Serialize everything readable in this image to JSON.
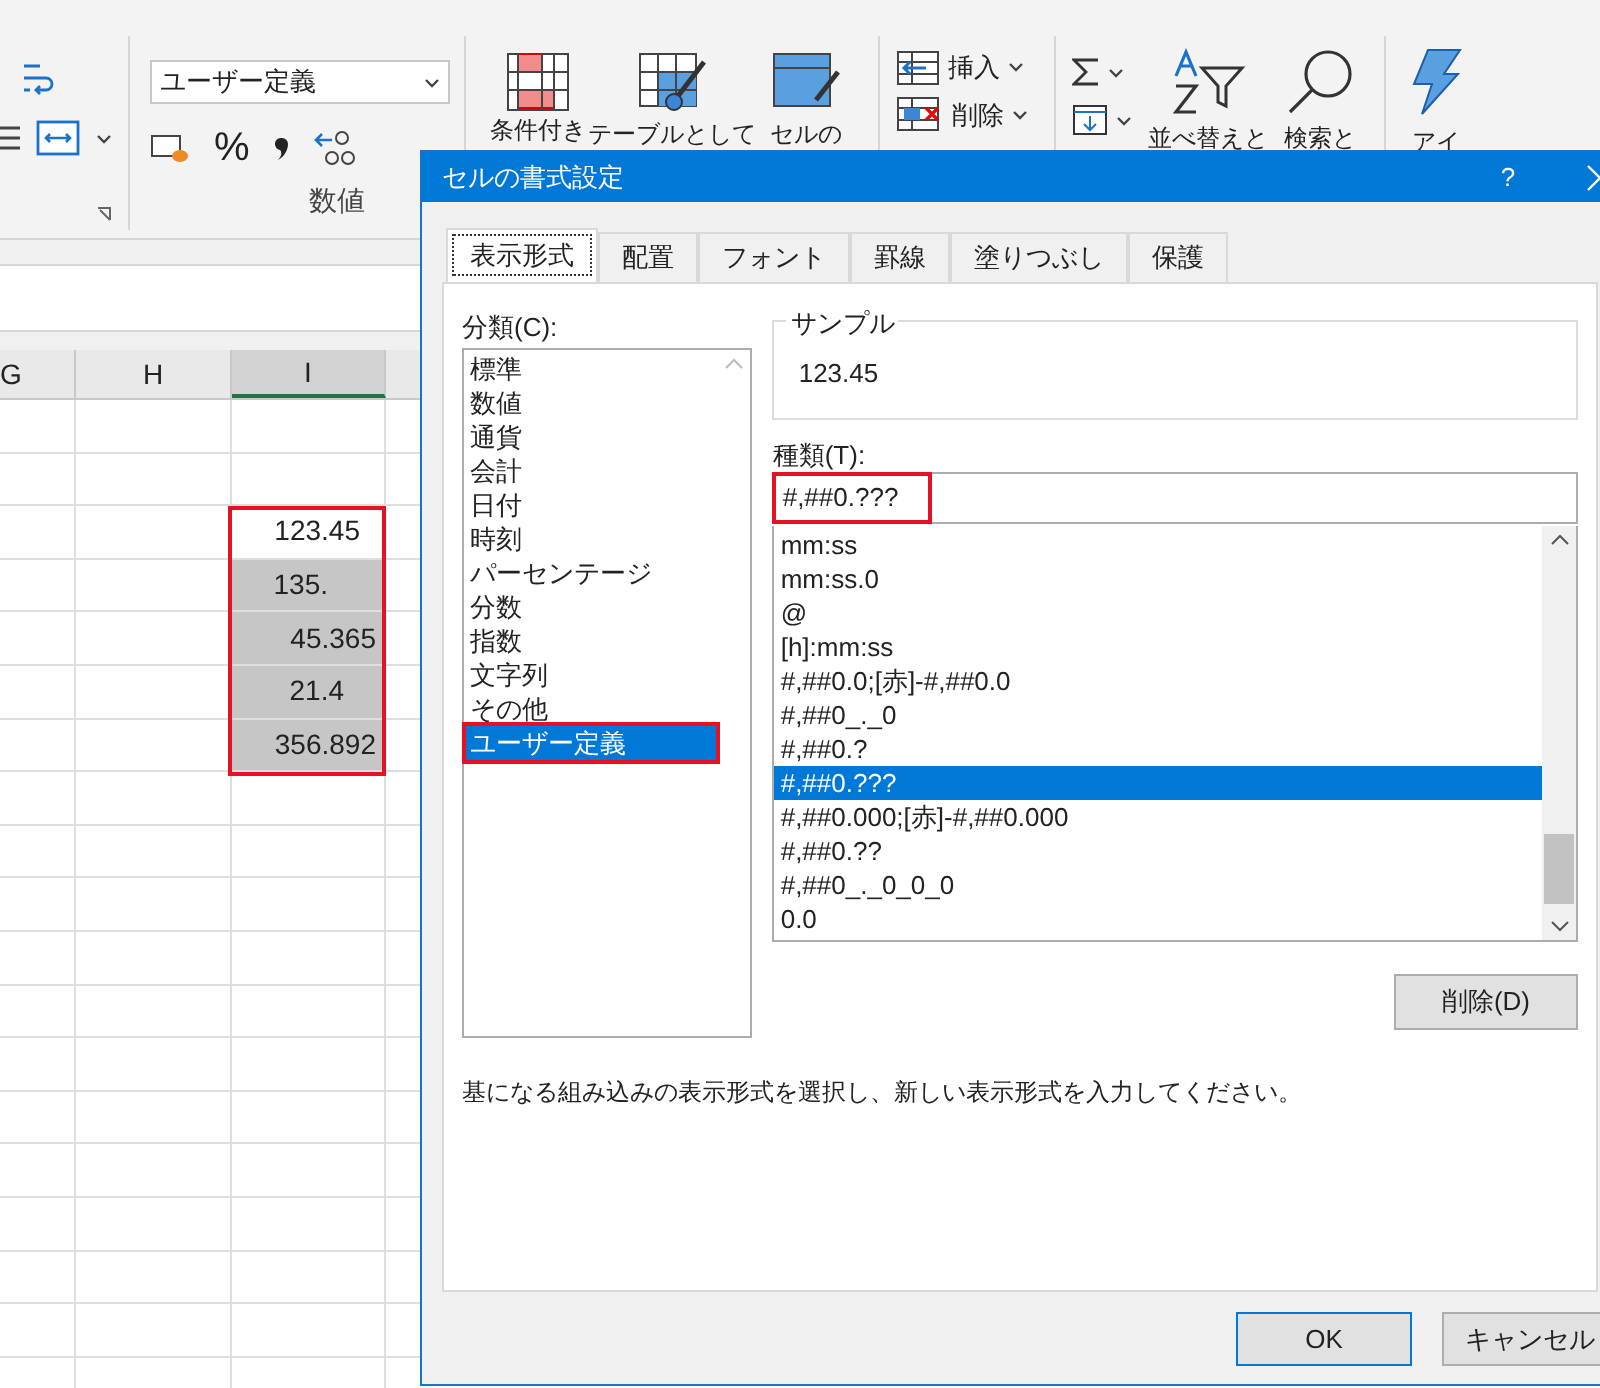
{
  "ribbon": {
    "number_format": "ユーザー定義",
    "percent_symbol": "%",
    "number_group_label": "数値",
    "style_buttons": [
      {
        "label": "条件付き",
        "kind": "conditional"
      },
      {
        "label": "テーブルとして",
        "kind": "table"
      },
      {
        "label": "セルの",
        "kind": "cellstyle"
      }
    ],
    "cells_buttons": [
      {
        "label": "挿入",
        "kind": "insert"
      },
      {
        "label": "削除",
        "kind": "delete"
      }
    ],
    "editing_buttons": [
      {
        "label": "並べ替えと",
        "kind": "sort"
      },
      {
        "label": "検索と",
        "kind": "find"
      }
    ],
    "ideas_label": "アイ"
  },
  "sheet": {
    "columns": [
      {
        "label": "G",
        "selected": false
      },
      {
        "label": "H",
        "selected": false
      },
      {
        "label": "I",
        "selected": true
      }
    ],
    "cells": [
      {
        "value": "123.45",
        "active": true
      },
      {
        "value": "135.",
        "active": false
      },
      {
        "value": "45.365",
        "active": false
      },
      {
        "value": "21.4",
        "active": false
      },
      {
        "value": "356.892",
        "active": false
      }
    ]
  },
  "dialog": {
    "title": "セルの書式設定",
    "help": "?",
    "tabs": [
      {
        "label": "表示形式",
        "selected": true
      },
      {
        "label": "配置",
        "selected": false
      },
      {
        "label": "フォント",
        "selected": false
      },
      {
        "label": "罫線",
        "selected": false
      },
      {
        "label": "塗りつぶし",
        "selected": false
      },
      {
        "label": "保護",
        "selected": false
      }
    ],
    "category_label": "分類(C):",
    "categories": [
      {
        "label": "標準",
        "selected": false,
        "annotated": false
      },
      {
        "label": "数値",
        "selected": false,
        "annotated": false
      },
      {
        "label": "通貨",
        "selected": false,
        "annotated": false
      },
      {
        "label": "会計",
        "selected": false,
        "annotated": false
      },
      {
        "label": "日付",
        "selected": false,
        "annotated": false
      },
      {
        "label": "時刻",
        "selected": false,
        "annotated": false
      },
      {
        "label": "パーセンテージ",
        "selected": false,
        "annotated": false
      },
      {
        "label": "分数",
        "selected": false,
        "annotated": false
      },
      {
        "label": "指数",
        "selected": false,
        "annotated": false
      },
      {
        "label": "文字列",
        "selected": false,
        "annotated": false
      },
      {
        "label": "その他",
        "selected": false,
        "annotated": false
      },
      {
        "label": "ユーザー定義",
        "selected": true,
        "annotated": true
      }
    ],
    "sample_label": "サンプル",
    "sample_value": "123.45",
    "type_label": "種類(T):",
    "type_value": "#,##0.???",
    "type_annotated": true,
    "formats": [
      {
        "label": "mm:ss",
        "selected": false
      },
      {
        "label": "mm:ss.0",
        "selected": false
      },
      {
        "label": "@",
        "selected": false
      },
      {
        "label": "[h]:mm:ss",
        "selected": false
      },
      {
        "label": "#,##0.0;[赤]-#,##0.0",
        "selected": false
      },
      {
        "label": "#,##0_._0",
        "selected": false
      },
      {
        "label": "#,##0.?",
        "selected": false
      },
      {
        "label": "#,##0.???",
        "selected": true
      },
      {
        "label": "#,##0.000;[赤]-#,##0.000",
        "selected": false
      },
      {
        "label": "#,##0.??",
        "selected": false
      },
      {
        "label": "#,##0_._0_0_0",
        "selected": false
      },
      {
        "label": "0.0",
        "selected": false
      }
    ],
    "delete_button": "削除(D)",
    "description": "基になる組み込みの表示形式を選択し、新しい表示形式を入力してください。",
    "ok_button": "OK",
    "cancel_button": "キャンセル"
  }
}
